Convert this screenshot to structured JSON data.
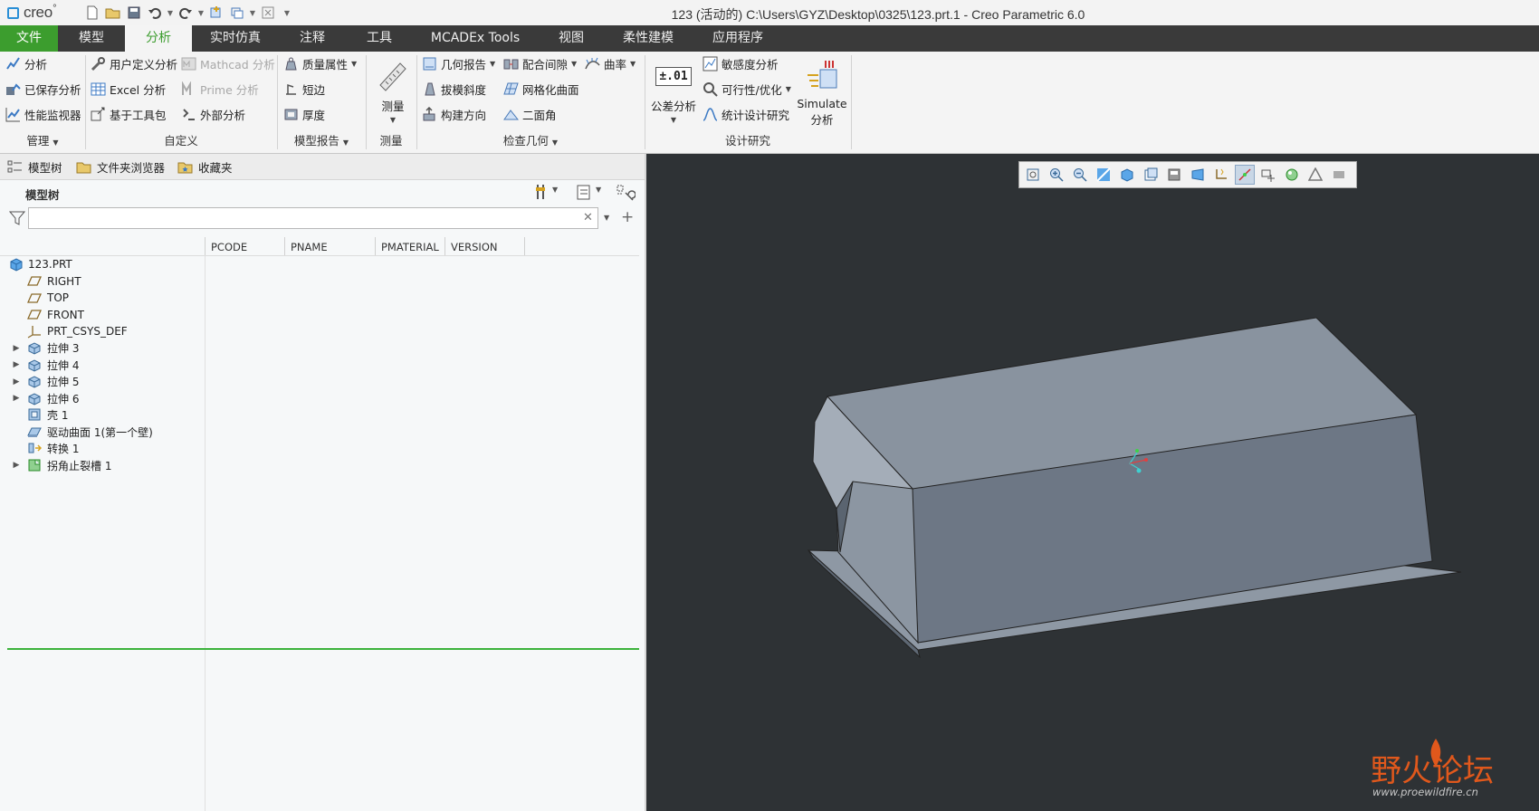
{
  "app": {
    "logo_text": "creo",
    "logo_mark": "°"
  },
  "window": {
    "title": "123 (活动的) C:\\Users\\GYZ\\Desktop\\0325\\123.prt.1 - Creo Parametric 6.0"
  },
  "quick_access": {
    "icons": [
      "new-icon",
      "open-icon",
      "save-icon",
      "undo-icon",
      "redo-icon",
      "regenerate-icon",
      "windows-icon",
      "close-window-icon",
      "customize-icon"
    ]
  },
  "tabs": [
    {
      "label": "文件"
    },
    {
      "label": "模型"
    },
    {
      "label": "分析"
    },
    {
      "label": "实时仿真"
    },
    {
      "label": "注释"
    },
    {
      "label": "工具"
    },
    {
      "label": "MCADEx Tools"
    },
    {
      "label": "视图"
    },
    {
      "label": "柔性建模"
    },
    {
      "label": "应用程序"
    }
  ],
  "ribbon": {
    "manage": {
      "label": "管理",
      "items": [
        {
          "label": "分析"
        },
        {
          "label": "已保存分析"
        },
        {
          "label": "性能监视器"
        }
      ]
    },
    "custom": {
      "label": "自定义",
      "items": [
        {
          "label": "用户定义分析"
        },
        {
          "label": "Mathcad 分析"
        },
        {
          "label": "Excel 分析"
        },
        {
          "label": "Prime 分析"
        },
        {
          "label": "基于工具包"
        },
        {
          "label": "外部分析"
        }
      ]
    },
    "model_report": {
      "label": "模型报告",
      "items": [
        {
          "label": "质量属性"
        },
        {
          "label": "短边"
        },
        {
          "label": "厚度"
        }
      ]
    },
    "measure": {
      "label": "测量",
      "button": "测量"
    },
    "inspect": {
      "label": "检查几何",
      "items": [
        {
          "label": "几何报告"
        },
        {
          "label": "配合间隙"
        },
        {
          "label": "曲率"
        },
        {
          "label": "拔模斜度"
        },
        {
          "label": "网格化曲面"
        },
        {
          "label": "构建方向"
        },
        {
          "label": "二面角"
        }
      ]
    },
    "design_study": {
      "label": "设计研究",
      "tolerance_icon_text": "±.01",
      "tolerance_label": "公差分析",
      "items": [
        {
          "label": "敏感度分析"
        },
        {
          "label": "可行性/优化"
        },
        {
          "label": "统计设计研究"
        }
      ],
      "simulate_line1": "Simulate",
      "simulate_line2": "分析"
    }
  },
  "navigator": {
    "tabs": [
      {
        "label": "模型树"
      },
      {
        "label": "文件夹浏览器"
      },
      {
        "label": "收藏夹"
      }
    ],
    "tree_title": "模型树",
    "search_value": "",
    "columns": [
      "PCODE",
      "PNAME",
      "PMATERIAL",
      "VERSION"
    ],
    "tree": [
      {
        "label": "123.PRT",
        "icon": "part-icon",
        "expandable": false
      },
      {
        "label": "RIGHT",
        "icon": "datum-plane-icon",
        "expandable": false
      },
      {
        "label": "TOP",
        "icon": "datum-plane-icon",
        "expandable": false
      },
      {
        "label": "FRONT",
        "icon": "datum-plane-icon",
        "expandable": false
      },
      {
        "label": "PRT_CSYS_DEF",
        "icon": "csys-icon",
        "expandable": false
      },
      {
        "label": "拉伸 3",
        "icon": "extrude-icon",
        "expandable": true
      },
      {
        "label": "拉伸 4",
        "icon": "extrude-icon",
        "expandable": true
      },
      {
        "label": "拉伸 5",
        "icon": "extrude-icon",
        "expandable": true
      },
      {
        "label": "拉伸 6",
        "icon": "extrude-icon",
        "expandable": true
      },
      {
        "label": "壳 1",
        "icon": "shell-icon",
        "expandable": false
      },
      {
        "label": "驱动曲面 1(第一个壁)",
        "icon": "sheetmetal-wall-icon",
        "expandable": false
      },
      {
        "label": "转换 1",
        "icon": "convert-icon",
        "expandable": false
      },
      {
        "label": "拐角止裂槽 1",
        "icon": "corner-relief-icon",
        "expandable": true
      }
    ]
  },
  "view_toolbar": {
    "icons": [
      "refit-icon",
      "zoom-in-icon",
      "zoom-out-icon",
      "repaint-icon",
      "shading-icon",
      "saved-views-icon",
      "view-manager-icon",
      "perspective-icon",
      "datum-display-icon",
      "spin-center-icon",
      "annotation-display-icon",
      "appearance-icon",
      "cross-section-icon",
      "display-style-icon"
    ],
    "active_index": 9
  },
  "watermark": {
    "title": "野火论坛",
    "url": "www.proewildfire.cn"
  },
  "colors": {
    "accent": "#3c9d2e",
    "tabbar": "#3a3a3a",
    "graphics_bg": "#2e3235",
    "model_top": "#8a94a0",
    "model_front": "#6c7684"
  }
}
